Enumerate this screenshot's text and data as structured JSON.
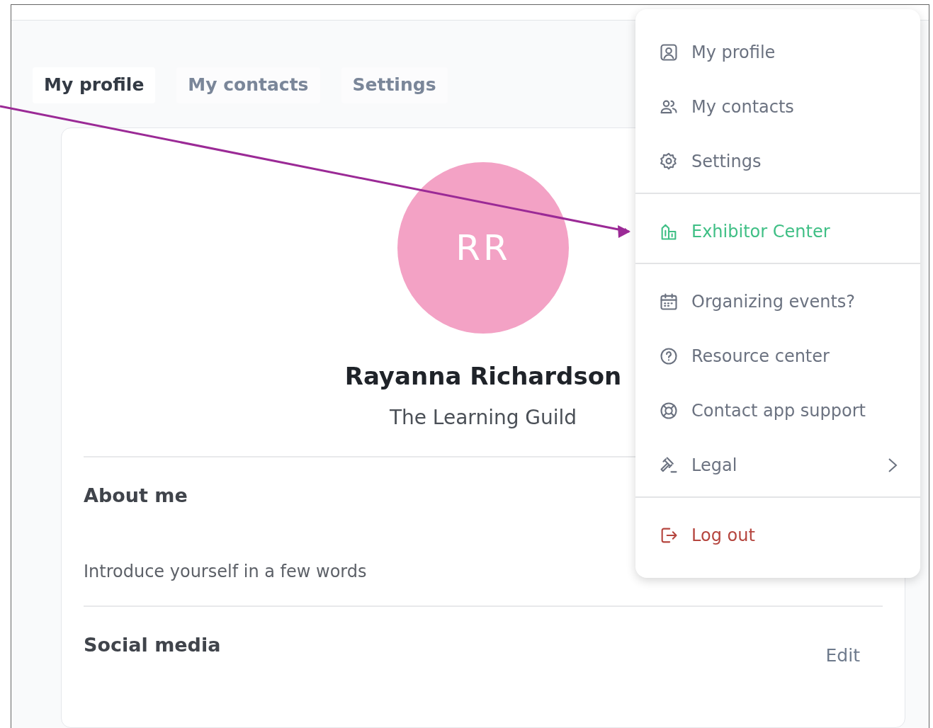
{
  "tabs": [
    {
      "label": "My profile",
      "selected": true
    },
    {
      "label": "My contacts",
      "selected": false
    },
    {
      "label": "Settings",
      "selected": false
    }
  ],
  "profile": {
    "initials": "RR",
    "name": "Rayanna Richardson",
    "organization": "The Learning Guild"
  },
  "sections": [
    {
      "title": "About me",
      "text": "Introduce yourself in a few words"
    },
    {
      "title": "Social media",
      "action": "Edit"
    }
  ],
  "menu": {
    "groups": [
      [
        {
          "label": "My profile",
          "kind": "plain"
        },
        {
          "label": "My contacts",
          "kind": "plain"
        },
        {
          "label": "Settings",
          "kind": "plain"
        }
      ],
      [
        {
          "label": "Exhibitor Center",
          "kind": "accent"
        }
      ],
      [
        {
          "label": "Organizing events?",
          "kind": "plain"
        },
        {
          "label": "Resource center",
          "kind": "plain"
        },
        {
          "label": "Contact app support",
          "kind": "plain"
        },
        {
          "label": "Legal",
          "kind": "submenu"
        }
      ],
      [
        {
          "label": "Log out",
          "kind": "danger"
        }
      ]
    ]
  }
}
